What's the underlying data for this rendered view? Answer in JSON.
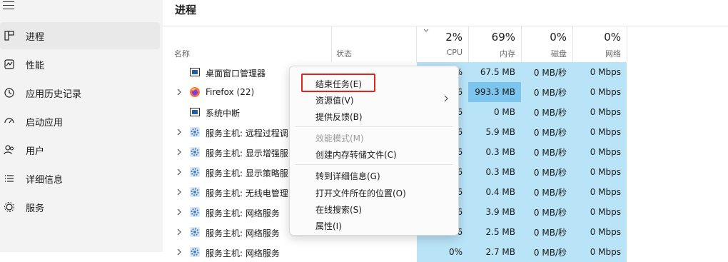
{
  "sidebar": {
    "items": [
      {
        "label": "进程",
        "icon": "processes-icon",
        "active": true
      },
      {
        "label": "性能",
        "icon": "performance-icon"
      },
      {
        "label": "应用历史记录",
        "icon": "app-history-icon"
      },
      {
        "label": "启动应用",
        "icon": "startup-icon"
      },
      {
        "label": "用户",
        "icon": "users-icon"
      },
      {
        "label": "详细信息",
        "icon": "details-icon"
      },
      {
        "label": "服务",
        "icon": "services-icon"
      }
    ]
  },
  "page": {
    "title": "进程"
  },
  "columns": {
    "name": "名称",
    "status": "状态",
    "cpu": {
      "pct": "2%",
      "label": "CPU"
    },
    "memory": {
      "pct": "69%",
      "label": "内存"
    },
    "disk": {
      "pct": "0%",
      "label": "磁盘"
    },
    "network": {
      "pct": "0%",
      "label": "网络"
    }
  },
  "rows": [
    {
      "name": "桌面窗口管理器",
      "cpu": "0.6%",
      "mem": "67.5 MB",
      "disk": "0 MB/秒",
      "net": "0 Mbps",
      "expandable": false,
      "icon": "window-icon"
    },
    {
      "name": "Firefox (22)",
      "cpu": "6",
      "mem": "993.3 MB",
      "disk": "0 MB/秒",
      "net": "0 Mbps",
      "expandable": true,
      "icon": "firefox-icon"
    },
    {
      "name": "系统中断",
      "cpu": "6",
      "mem": "0 MB",
      "disk": "0 MB/秒",
      "net": "0 Mbps",
      "expandable": false,
      "icon": "window-icon"
    },
    {
      "name": "服务主机: 远程过程调",
      "cpu": "6",
      "mem": "5.9 MB",
      "disk": "0 MB/秒",
      "net": "0 Mbps",
      "expandable": true,
      "icon": "gear-icon"
    },
    {
      "name": "服务主机: 显示增强服",
      "cpu": "6",
      "mem": "0.3 MB",
      "disk": "0 MB/秒",
      "net": "0 Mbps",
      "expandable": true,
      "icon": "gear-icon"
    },
    {
      "name": "服务主机: 显示策略服",
      "cpu": "6",
      "mem": "0.3 MB",
      "disk": "0 MB/秒",
      "net": "0 Mbps",
      "expandable": true,
      "icon": "gear-icon"
    },
    {
      "name": "服务主机: 无线电管理",
      "cpu": "6",
      "mem": "0.4 MB",
      "disk": "0 MB/秒",
      "net": "0 Mbps",
      "expandable": true,
      "icon": "gear-icon"
    },
    {
      "name": "服务主机: 网络服务",
      "cpu": "6",
      "mem": "3.9 MB",
      "disk": "0 MB/秒",
      "net": "0 Mbps",
      "expandable": true,
      "icon": "gear-icon"
    },
    {
      "name": "服务主机: 网络服务",
      "cpu": "6",
      "mem": "2.5 MB",
      "disk": "0 MB/秒",
      "net": "0 Mbps",
      "expandable": true,
      "icon": "gear-icon"
    },
    {
      "name": "服务主机: 网络服务",
      "cpu": "0%",
      "mem": "2.7 MB",
      "disk": "0 MB/秒",
      "net": "0 Mbps",
      "expandable": true,
      "icon": "gear-icon"
    }
  ],
  "context_menu": {
    "items": [
      {
        "label": "结束任务(E)",
        "enabled": true
      },
      {
        "label": "资源值(V)",
        "enabled": true,
        "submenu": true
      },
      {
        "label": "提供反馈(B)",
        "enabled": true
      },
      {
        "label": "效能模式(M)",
        "enabled": false
      },
      {
        "label": "创建内存转储文件(C)",
        "enabled": true
      },
      {
        "label": "转到详细信息(G)",
        "enabled": true
      },
      {
        "label": "打开文件所在的位置(O)",
        "enabled": true
      },
      {
        "label": "在线搜索(S)",
        "enabled": true
      },
      {
        "label": "属性(I)",
        "enabled": true
      }
    ]
  },
  "colors": {
    "accent": "#e0241b",
    "usage_light": "#b9e3f7",
    "usage_hot": "#7cc5ee"
  }
}
